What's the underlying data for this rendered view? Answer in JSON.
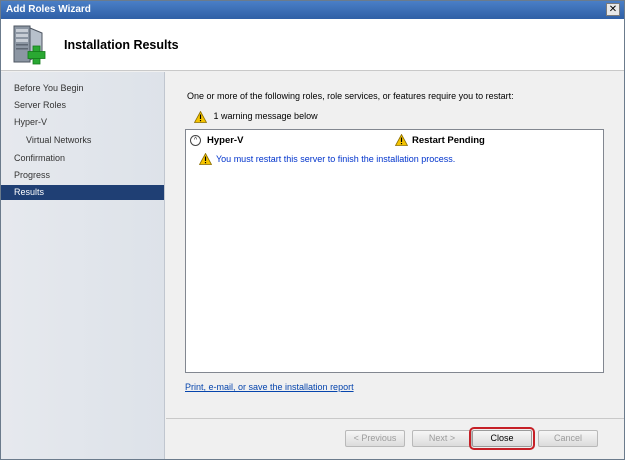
{
  "window": {
    "title": "Add Roles Wizard",
    "close_glyph": "✕"
  },
  "header": {
    "title": "Installation Results",
    "icon": "server-add-icon"
  },
  "sidebar": {
    "items": [
      {
        "label": "Before You Begin",
        "sub": false,
        "active": false
      },
      {
        "label": "Server Roles",
        "sub": false,
        "active": false
      },
      {
        "label": "Hyper-V",
        "sub": false,
        "active": false
      },
      {
        "label": "Virtual Networks",
        "sub": true,
        "active": false
      },
      {
        "label": "Confirmation",
        "sub": false,
        "active": false
      },
      {
        "label": "Progress",
        "sub": false,
        "active": false
      },
      {
        "label": "Results",
        "sub": false,
        "active": true
      }
    ]
  },
  "content": {
    "intro": "One or more of the following roles, role services, or features require you to restart:",
    "warning_summary": "1 warning message below",
    "results": [
      {
        "collapse_glyph": "^",
        "role": "Hyper-V",
        "status": "Restart Pending",
        "message": "You must restart this server to finish the installation process."
      }
    ],
    "report_link": "Print, e-mail, or save the installation report"
  },
  "buttons": {
    "previous": "< Previous",
    "next": "Next >",
    "close": "Close",
    "cancel": "Cancel"
  },
  "colors": {
    "titlebar": "#3a6db5",
    "sidebar_active": "#1f3f74",
    "link": "#0645ad",
    "message": "#0033cc",
    "close_highlight": "#c62027",
    "warning": "#f5c400"
  }
}
